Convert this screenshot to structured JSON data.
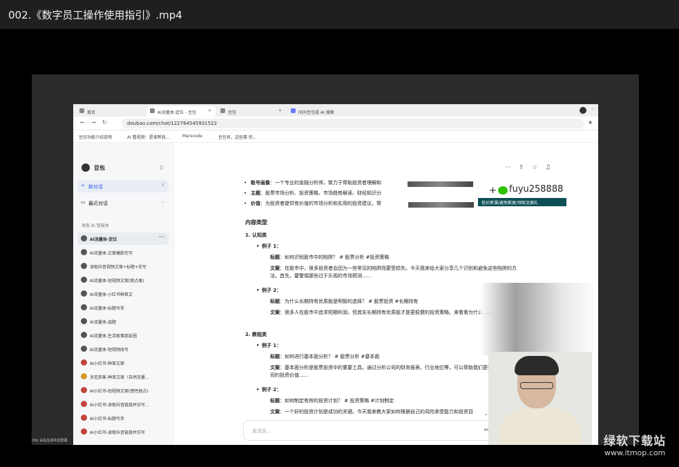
{
  "player": {
    "title": "002.《数字员工操作使用指引》.mp4"
  },
  "browser": {
    "tabs": [
      "首页",
      "AI流量体-定位 - 豆包",
      "豆包",
      "问问豆包或 AI 搜索"
    ],
    "url": "doubao.com/chat/122764545931522",
    "bookmarks": [
      "豆包功能介绍说明",
      "AI 看视频：是谁帮我...",
      "Marscode",
      "豆包有，这些事 你..."
    ]
  },
  "sidebar": {
    "app_name": "豆包",
    "new_chat": "新对话",
    "new_chat_shortcut": "K",
    "recent_chats": "最近对话",
    "discover": "发现 AI 智能体",
    "agents": [
      "AI流量体-定位",
      "AI流量体-文案爆款仿写",
      "读取抖音视频文案+标题+仿写",
      "AI流量体-短视频文案(观点类)",
      "AI流量体-小红书种草文",
      "AI流量体-标题写手",
      "AI流量体-选题",
      "AI流量体-生活故事朋友圈",
      "AI流量体-短视频改写",
      "AI小红书-种草文案",
      "涉足获客-种草文案（自然流量...",
      "AI小红书-短视频文案(感性观点)",
      "AI小红书-读取抖音链接并仿写...",
      "AI小红书-标题写手",
      "AI小红书-读取抖音链接并仿写"
    ]
  },
  "content": {
    "bullets": [
      {
        "label": "账号画像",
        "text": "：一个专业的金融分析师，致力于帮助投资者理解和"
      },
      {
        "label": "主题",
        "text": "：股票市场分析、投资策略、市场趋势解读、财经知识分"
      },
      {
        "label": "价值",
        "text": "：为投资者提供有价值的市场分析和实用的投资建议，帮"
      }
    ],
    "heading": "内容类型",
    "sections": [
      {
        "title": "1.  认知类",
        "examples": [
          {
            "name": "例子 1：",
            "title_label": "标题",
            "title": "：如何识别股市中的陷阱？ # 股票分析 #投资策略",
            "copy_label": "文案",
            "copy": "：在股市中，很多投资者会因为一些常见的陷阱而蒙受损失。今天我来给大家分享几个识别和避免这些陷阱的方法。首先，要警惕那些过于乐观的市场预测......"
          },
          {
            "name": "例子 2：",
            "title_label": "标题",
            "title": "：为什么长期持有优质股是明智的选择？ # 股票投资 #长期持有",
            "copy_label": "文案",
            "copy": "：很多人在股市中追求短期利润，但其实长期持有优质股才是更稳健的投资策略。来看看为什么......"
          }
        ]
      },
      {
        "title": "2.  教程类",
        "examples": [
          {
            "name": "例子 1：",
            "title_label": "标题",
            "title": "：如何进行基本面分析？ # 股票分析 #基本面",
            "copy_label": "文案",
            "copy": "：基本面分析是股票投资中的重要工具。通过分析公司的财务报表、行业地位等，可以帮助我们更好地判断一家公司的投资价值......"
          },
          {
            "name": "例子 2：",
            "title_label": "标题",
            "title": "：如何制定有效的投资计划？ # 投资策略 #计划制定",
            "copy_label": "文案",
            "copy": "：一个好的投资计划是成功的关键。今天我来教大家如何根据自己的风险承受能力和投资目"
          }
        ]
      }
    ],
    "composer_placeholder": "发消息..."
  },
  "overlay": {
    "wechat_id": "fuyu258888",
    "promo": "低价新课/避免断更/领取见面礼",
    "caption": "Dify 白先生的共享屏幕",
    "site_brand": "绿软下载站",
    "site_url": "www.itmop.com"
  }
}
